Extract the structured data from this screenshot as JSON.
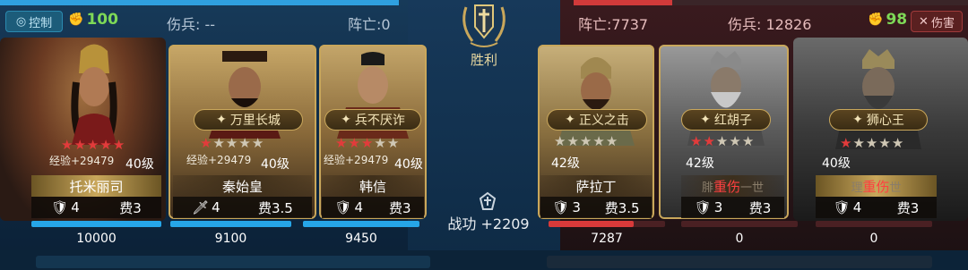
{
  "top_left": {
    "control_label": "控制",
    "morale": "100",
    "wounded_label": "伤兵:",
    "wounded_value": "--",
    "dead_label": "阵亡:0"
  },
  "top_right": {
    "dead_label": "阵亡:7737",
    "wounded_label": "伤兵:",
    "wounded_value": "12826",
    "morale": "98",
    "harm_label": "伤害"
  },
  "center": {
    "victory": "胜利",
    "merit": "战功 +2209"
  },
  "left_units": [
    {
      "name": "托米丽司",
      "skill": "",
      "stars": 5,
      "exp": "经验+29479",
      "level": "40级",
      "count": "4",
      "cost_label": "费3",
      "hp": "10000",
      "hp_fraction": 1.0
    },
    {
      "name": "秦始皇",
      "skill": "万里长城",
      "stars": 1,
      "exp": "经验+29479",
      "level": "40级",
      "count": "4",
      "cost_label": "费3.5",
      "hp": "9100",
      "hp_fraction": 1.0
    },
    {
      "name": "韩信",
      "skill": "兵不厌诈",
      "stars": 3,
      "exp": "经验+29479",
      "level": "40级",
      "count": "4",
      "cost_label": "费3",
      "hp": "9450",
      "hp_fraction": 1.0
    }
  ],
  "right_units": [
    {
      "name": "萨拉丁",
      "skill": "正义之击",
      "stars": 0,
      "level": "42级",
      "count": "3",
      "cost_label": "费3.5",
      "hp": "7287",
      "hp_fraction": 0.73
    },
    {
      "name_hurt": "重伤",
      "name_dim_a": "腓",
      "name_dim_b": "一世",
      "skill": "红胡子",
      "stars": 2,
      "level": "42级",
      "count": "3",
      "cost_label": "费3",
      "hp": "0",
      "hp_fraction": 0
    },
    {
      "name_hurt": "重伤",
      "name_dim_a": "理",
      "name_dim_b": "世",
      "skill": "狮心王",
      "stars": 1,
      "level": "40级",
      "count": "4",
      "cost_label": "费3",
      "hp": "0",
      "hp_fraction": 0
    }
  ],
  "colors": {
    "blue_hp": "#26a6e8",
    "red_hp": "#d83a3a",
    "gold": "#c9a75b",
    "morale_green": "#7ed957"
  },
  "icons": [
    "control-icon",
    "fist-icon",
    "close-icon",
    "wreath-sword-emblem",
    "merit-icon",
    "tank-icon",
    "sword-icon"
  ]
}
